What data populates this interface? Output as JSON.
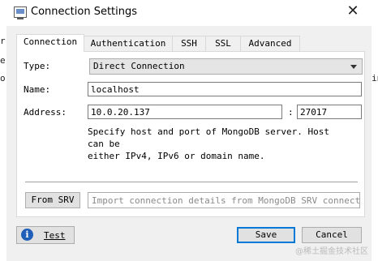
{
  "window": {
    "title": "Connection Settings",
    "title_icon": "app-window-icon",
    "close_icon": "close-icon",
    "close_glyph": "✕"
  },
  "background_fragments": {
    "left_1": "r",
    "left_2": "e",
    "left_3": "o",
    "right_1": "in"
  },
  "tabs": [
    {
      "label": "Connection",
      "active": true
    },
    {
      "label": "Authentication",
      "active": false
    },
    {
      "label": "SSH",
      "active": false
    },
    {
      "label": "SSL",
      "active": false
    },
    {
      "label": "Advanced",
      "active": false
    }
  ],
  "connection": {
    "type_label": "Type:",
    "type_value": "Direct Connection",
    "name_label": "Name:",
    "name_value": "localhost",
    "address_label": "Address:",
    "host_value": "10.0.20.137",
    "port_separator": ":",
    "port_value": "27017",
    "hint_line1": "Specify host and port of MongoDB server. Host can be",
    "hint_line2": "either IPv4, IPv6 or domain name."
  },
  "srv": {
    "button_label": "From SRV",
    "input_placeholder": "Import connection details from MongoDB SRV connection…"
  },
  "footer": {
    "test_label": "Test",
    "test_icon": "info-icon",
    "save_label": "Save",
    "cancel_label": "Cancel",
    "watermark": "@稀土掘金技术社区"
  },
  "colors": {
    "accent": "#0078d7",
    "info_icon": "#1f5fb8"
  }
}
